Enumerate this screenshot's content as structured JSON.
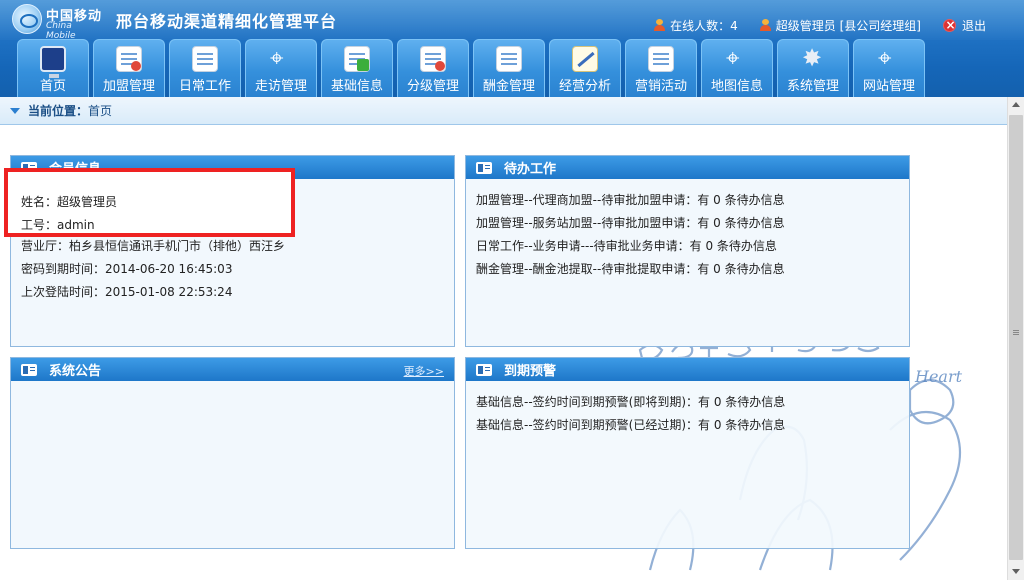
{
  "header": {
    "logo_cn": "中国移动",
    "logo_en": "China Mobile",
    "title": "邢台移动渠道精细化管理平台",
    "online_label": "在线人数：4",
    "user_label": "超级管理员 [县公司经理组]",
    "logout_label": "退出"
  },
  "nav": {
    "tabs": [
      {
        "label": "首页",
        "icon": "monitor-icon"
      },
      {
        "label": "加盟管理",
        "icon": "alliance-icon"
      },
      {
        "label": "日常工作",
        "icon": "document-icon"
      },
      {
        "label": "走访管理",
        "icon": "satellite-icon"
      },
      {
        "label": "基础信息",
        "icon": "info-icon"
      },
      {
        "label": "分级管理",
        "icon": "grade-icon"
      },
      {
        "label": "酬金管理",
        "icon": "reward-icon"
      },
      {
        "label": "经营分析",
        "icon": "analysis-icon"
      },
      {
        "label": "营销活动",
        "icon": "marketing-icon"
      },
      {
        "label": "地图信息",
        "icon": "map-icon"
      },
      {
        "label": "系统管理",
        "icon": "settings-icon"
      },
      {
        "label": "网站管理",
        "icon": "website-icon"
      }
    ]
  },
  "breadcrumb": {
    "label": "当前位置：",
    "current": "首页"
  },
  "member_panel": {
    "title": "会员信息",
    "name": "姓名：超级管理员",
    "employee_id": "工号：admin",
    "hall": "营业厅：柏乡县恒信通讯手机门市（排他）西汪乡",
    "password_expiry": "密码到期时间：2014-06-20 16:45:03",
    "last_login": "上次登陆时间：2015-01-08 22:53:24"
  },
  "todo_panel": {
    "title": "待办工作",
    "items": [
      "加盟管理--代理商加盟--待审批加盟申请：有 0 条待办信息",
      "加盟管理--服务站加盟--待审批加盟申请：有 0 条待办信息",
      "日常工作--业务申请---待审批业务申请：有 0 条待办信息",
      "酬金管理--酬金池提取--待审批提取申请：有 0 条待办信息"
    ]
  },
  "notice_panel": {
    "title": "系统公告",
    "more_label": "更多>>"
  },
  "expire_panel": {
    "title": "到期预警",
    "items": [
      "基础信息--签约时间到期预警(即将到期)：有 0 条待办信息",
      "基础信息--签约时间到期预警(已经过期)：有 0 条待办信息"
    ]
  },
  "background_art": {
    "text": "Heart"
  },
  "colors": {
    "header_blue": "#1f72c4",
    "panel_header_blue": "#2a84d4",
    "highlight_red": "#ee2222"
  }
}
